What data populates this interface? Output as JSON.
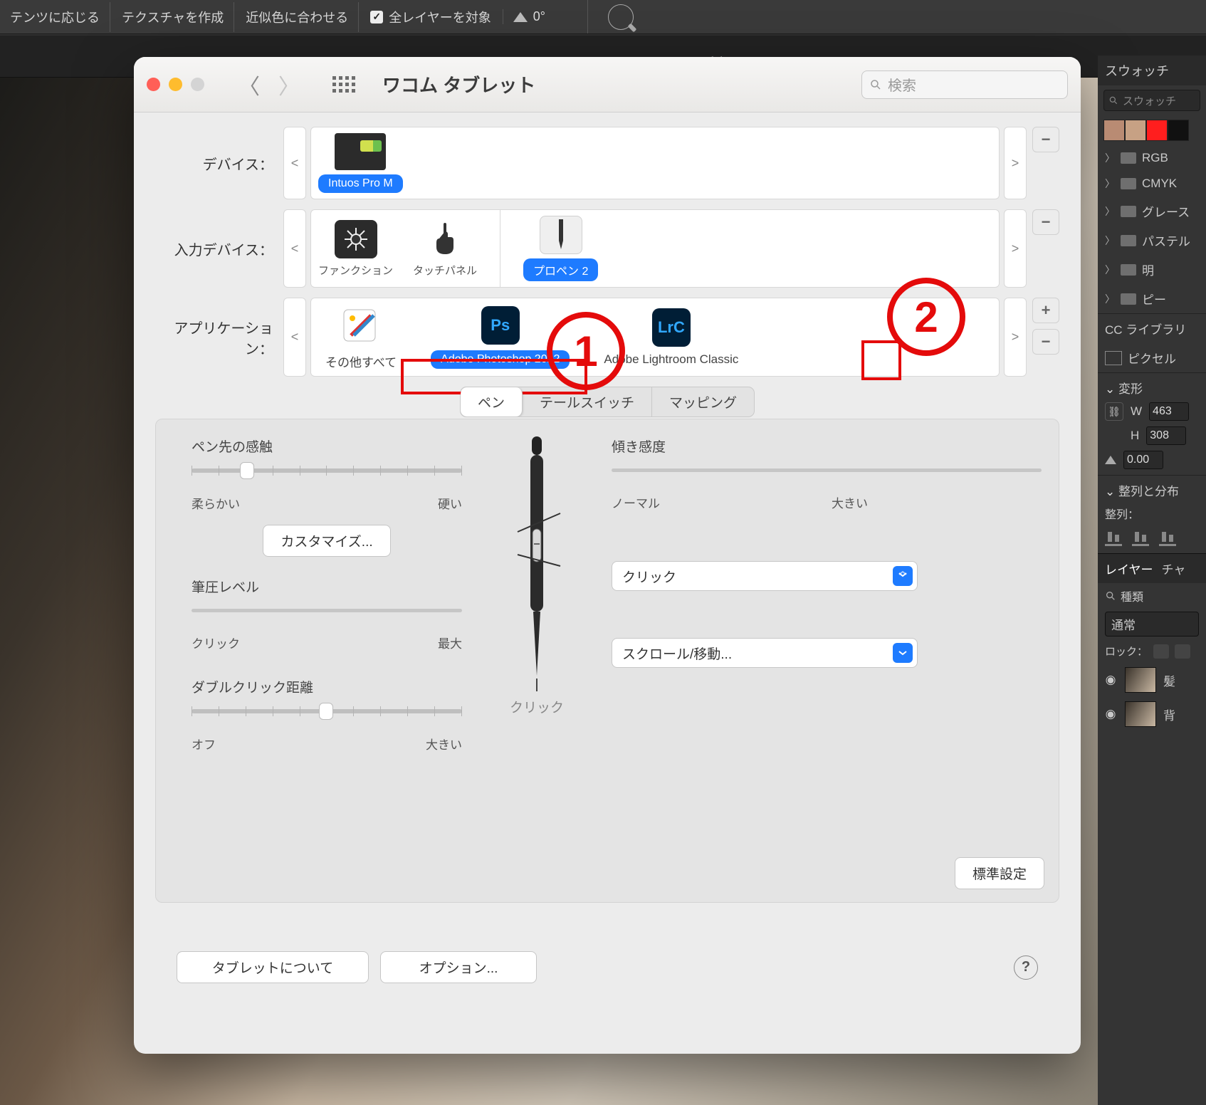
{
  "ps_options": {
    "items": [
      "テンツに応じる",
      "テクスチャを作成",
      "近似色に合わせる"
    ],
    "checkbox_label": "全レイヤーを対象",
    "angle_icon": "△",
    "angle_value": "0°"
  },
  "window": {
    "title": "ワコム タブレット",
    "search_placeholder": "検索",
    "rows": {
      "device_label": "デバイス：",
      "device_item": "Intuos Pro M",
      "input_label": "入力デバイス：",
      "input_items": [
        "ファンクション",
        "タッチパネル",
        "プロペン 2"
      ],
      "app_label": "アプリケーション：",
      "app_items": [
        "その他すべて",
        "Adobe Photoshop 2022",
        "Adobe Lightroom Classic"
      ]
    },
    "tabs": [
      "ペン",
      "テールスイッチ",
      "マッピング"
    ],
    "panel": {
      "tip_feel": "ペン先の感触",
      "tip_soft": "柔らかい",
      "tip_hard": "硬い",
      "customize": "カスタマイズ...",
      "pressure": "筆圧レベル",
      "pressure_min": "クリック",
      "pressure_max": "最大",
      "dbl": "ダブルクリック距離",
      "dbl_off": "オフ",
      "dbl_big": "大きい",
      "tilt": "傾き感度",
      "tilt_normal": "ノーマル",
      "tilt_big": "大きい",
      "dd1": "クリック",
      "dd2": "スクロール/移動...",
      "pen_click": "クリック",
      "default_btn": "標準設定"
    },
    "footer": {
      "about": "タブレットについて",
      "options": "オプション..."
    }
  },
  "annotations": {
    "one": "1",
    "two": "2"
  },
  "ps_right": {
    "swatches": "スウォッチ",
    "search_ph": "スウォッチ",
    "folders": [
      "RGB",
      "CMYK",
      "グレース",
      "パステル",
      "明"
    ],
    "cc_lib": "CC ライブラリ",
    "pixel": "ピクセル",
    "transform_hdr": "変形",
    "w_label": "W",
    "w_val": "463",
    "h_label": "H",
    "h_val": "308",
    "deg_val": "0.00",
    "align_hdr": "整列と分布",
    "align_label": "整列：",
    "layers_tab1": "レイヤー",
    "layers_tab2": "チャ",
    "kind": "種類",
    "blend": "通常",
    "lock": "ロック：",
    "layer1": "髪",
    "layer2": "背"
  },
  "flyout": "◀◀"
}
